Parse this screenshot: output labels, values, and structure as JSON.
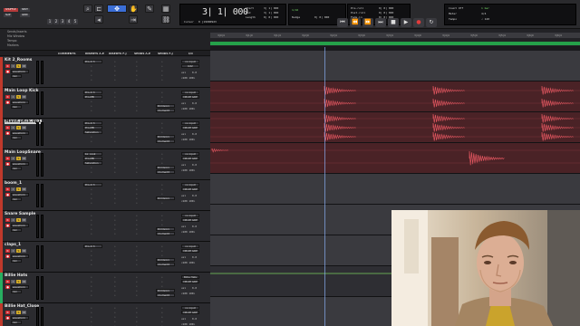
{
  "transport": {
    "mode_labels": [
      "SHUFFLE",
      "SPOT",
      "SLIP",
      "GRID"
    ],
    "counter_main": "3| 1| 000",
    "counter_label": "Cursor",
    "counter_sub": "0 |19980923",
    "counter_rows": [
      {
        "label": "Start",
        "value": "3| 1| 000"
      },
      {
        "label": "End",
        "value": "3| 1| 000"
      },
      {
        "label": "Length",
        "value": "0| 0| 000"
      }
    ],
    "bpm_label": "Nudge",
    "nudge_value": "0| 0| 000",
    "grid_value": "1/16",
    "number_buttons": [
      "1",
      "2",
      "3",
      "4",
      "5"
    ],
    "pre_post": [
      {
        "label": "Pre-roll",
        "value": "0| 0| 000"
      },
      {
        "label": "Post-roll",
        "value": "0| 0| 000"
      },
      {
        "label": "Fade-in",
        "value": "0| 0| 000"
      }
    ],
    "right_rows": [
      {
        "label": "Count Off",
        "value": "1 bar"
      },
      {
        "label": "Meter",
        "value": "4/4"
      },
      {
        "label": "Tempo",
        "value": "♩ 120"
      }
    ],
    "colors": {
      "accent": "#3b6ed6",
      "green": "#79e06a"
    }
  },
  "sidebar": {
    "items": [
      "Sends/Inserts",
      "Mix Window",
      "Tempo",
      "Markers"
    ]
  },
  "columns": [
    "COMMENTS",
    "INSERTS A-E",
    "INSERTS F-J",
    "SENDS A-E",
    "SENDS F-J",
    "I/O"
  ],
  "tracks": [
    {
      "name": "Kit 2_Rooms",
      "selected": false,
      "strip": "#c0392b",
      "inserts": [
        "Pro-Q 3"
      ],
      "sends": [],
      "io_in": "no input",
      "io_out": "Kit2",
      "vol": "0.0",
      "lane": "grey",
      "wave": "none"
    },
    {
      "name": "Main Loop Kick",
      "selected": false,
      "strip": "#c0392b",
      "inserts": [
        "Pro-Q 3",
        "Pro-MB"
      ],
      "sends": [
        "DrmGrp1",
        "drumedit"
      ],
      "io_in": "no input",
      "io_out": "DRUM GRP",
      "vol": "0.0",
      "lane": "red",
      "wave": "kick"
    },
    {
      "name": "Maint.pKck.dp1",
      "selected": true,
      "strip": "#c0392b",
      "inserts": [
        "Pro-Q 3",
        "Pro-MB",
        "Saturation"
      ],
      "sends": [
        "DrmGrp1",
        "drumedit"
      ],
      "io_in": "no input",
      "io_out": "DRUM GRP",
      "vol": "0.0",
      "lane": "red",
      "wave": "kick2"
    },
    {
      "name": "Main LoopSnare",
      "selected": false,
      "strip": "#c0392b",
      "inserts": [
        "bx_cook",
        "Pro-MB",
        "Saturation"
      ],
      "sends": [
        "DrmGrp1",
        "drumedit"
      ],
      "io_in": "no input",
      "io_out": "DRUM GRP",
      "vol": "0.0",
      "lane": "red",
      "wave": "snare"
    },
    {
      "name": "boom_1",
      "selected": false,
      "strip": "#c0392b",
      "inserts": [
        "Pro-Q 3"
      ],
      "sends": [
        "DrmGrp1"
      ],
      "io_in": "no input",
      "io_out": "DRUM GRP",
      "vol": "0.0",
      "lane": "grey",
      "wave": "none"
    },
    {
      "name": "Snare Sample",
      "selected": false,
      "strip": "#c0392b",
      "inserts": [],
      "sends": [
        "DrmGrp1",
        "drumedit"
      ],
      "io_in": "no input",
      "io_out": "DRUM GRP",
      "vol": "0.0",
      "lane": "grey",
      "wave": "none"
    },
    {
      "name": "claps_1",
      "selected": false,
      "strip": "#c0392b",
      "inserts": [
        "Pro-Q 3"
      ],
      "sends": [
        "DrmGrp1",
        "drumedit"
      ],
      "io_in": "no input",
      "io_out": "DRUM GRP",
      "vol": "0.0",
      "lane": "grey",
      "wave": "none"
    },
    {
      "name": "Billie Hats",
      "selected": false,
      "strip": "#27ae60",
      "inserts": [],
      "sends": [
        "DrmGrp1",
        "drumedit"
      ],
      "io_in": "Billie Hats",
      "io_out": "DRUM GRP",
      "vol": "0.0",
      "lane": "dark",
      "wave": "line"
    },
    {
      "name": "Billie Hat_Close",
      "selected": false,
      "strip": "#c0392b",
      "inserts": [],
      "sends": [],
      "io_in": "no input",
      "io_out": "DRUM GRP",
      "vol": "0.0",
      "lane": "grey",
      "wave": "none"
    }
  ],
  "track_controls": {
    "view_label": "waveform",
    "playlist_label": "dyn",
    "rec_label": "R",
    "solo_label": "S",
    "mute_label": "M"
  },
  "ruler": {
    "ticks": [
      "3|0|4",
      "3|1|0",
      "3|1|4",
      "3|2|0",
      "3|2|4",
      "3|3|0",
      "3|3|4",
      "3|4|0",
      "3|4|4",
      "3|5|0",
      "3|5|4",
      "3|6|0",
      "3|6|4"
    ]
  },
  "webcam": {
    "description_icon": "presenter-video"
  }
}
